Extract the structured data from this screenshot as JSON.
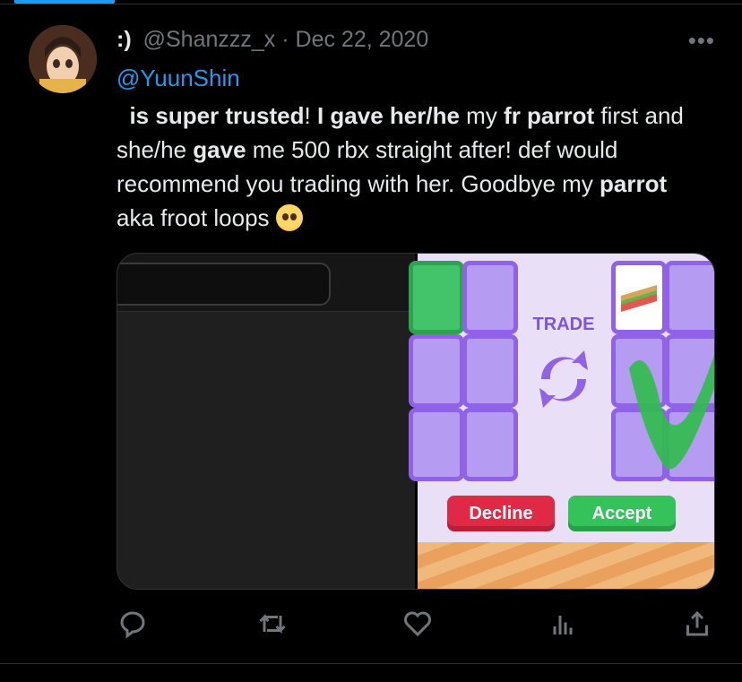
{
  "tweet": {
    "display_name": ":)",
    "handle": "@Shanzzz_x",
    "separator": "·",
    "date": "Dec 22, 2020",
    "reply_to": "@YuunShin",
    "text_parts": {
      "p1": "is super trusted",
      "p2": "! ",
      "p3": "I gave her/he",
      "p4": " my ",
      "p5": "fr parrot",
      "p6": " first and she/he ",
      "p7": "gave",
      "p8": " me 500 rbx straight after! def would recommend you trading with her. Goodbye my ",
      "p9": "parrot",
      "p10": " aka froot loops "
    }
  },
  "media": {
    "trade_label": "TRADE",
    "decline_label": "Decline",
    "accept_label": "Accept"
  },
  "icons": {
    "more": "more-icon",
    "reply": "reply-icon",
    "retweet": "retweet-icon",
    "like": "like-icon",
    "views": "views-icon",
    "share": "share-icon",
    "emoji": "pleading-face-emoji"
  },
  "colors": {
    "accent": "#1d9bf0",
    "muted": "#71767b",
    "text": "#e7e9ea",
    "decline": "#e02945",
    "accept": "#34c25a",
    "trade_purple": "#8f62e8"
  }
}
